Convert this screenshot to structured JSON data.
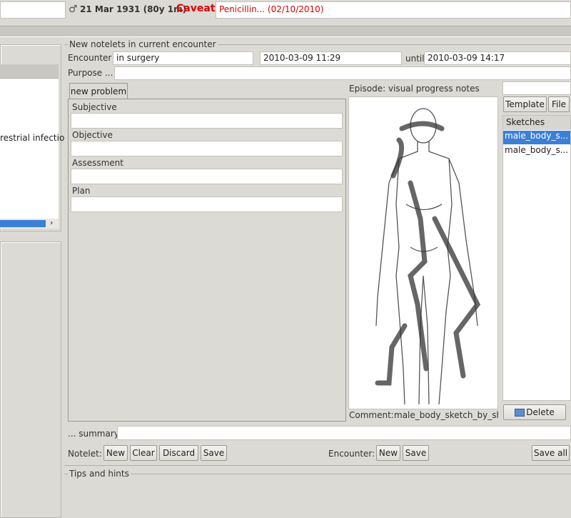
{
  "patient": {
    "gender_symbol": "♂",
    "dob_age": "21 Mar 1931 (80y 1m)",
    "caveat_label": "Caveat",
    "caveat_value": "Penicillin... (02/10/2010)"
  },
  "left_panel": {
    "list_item_text": "restrial infectio",
    "scroll_right": "›"
  },
  "notelets": {
    "title": "New notelets in current encounter",
    "encounter_label": "Encounter",
    "encounter_type": "in surgery",
    "start_time": "2010-03-09 11:29",
    "until_label": "until",
    "end_time": "2010-03-09 14:17",
    "purpose_label": "Purpose ..."
  },
  "problem": {
    "tab_label": "new problem",
    "sections": [
      {
        "label": "Subjective"
      },
      {
        "label": "Objective"
      },
      {
        "label": "Assessment"
      },
      {
        "label": "Plan"
      }
    ]
  },
  "episode": {
    "label": "Episode:",
    "value": "visual progress notes",
    "comment_label": "Comment:",
    "comment_value": "male_body_sketch_by_sh"
  },
  "right_panel": {
    "template_button": "Template",
    "file_button": "File",
    "sketches_header": "Sketches",
    "sketches": [
      "male_body_s...",
      "male_body_s..."
    ],
    "delete_button": "Delete"
  },
  "summary": {
    "label": "... summary"
  },
  "notelet_bar": {
    "label": "Notelet:",
    "new": "New",
    "clear": "Clear",
    "discard": "Discard",
    "save": "Save"
  },
  "encounter_bar": {
    "label": "Encounter:",
    "new": "New",
    "save": "Save",
    "save_all": "Save all"
  },
  "tips": {
    "title": "Tips and hints"
  },
  "colors": {
    "caveat": "#e00000",
    "selection": "#3c7fd6"
  }
}
